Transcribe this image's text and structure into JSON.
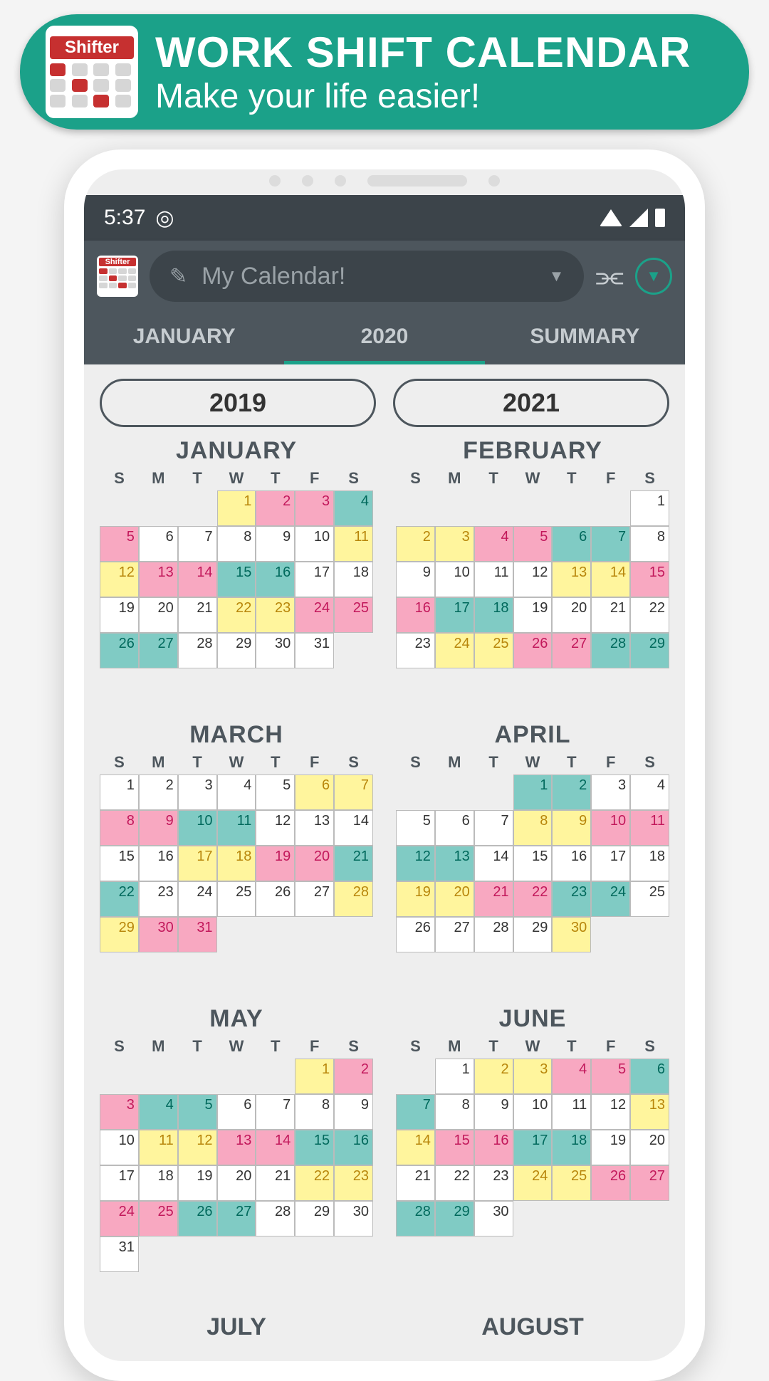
{
  "banner": {
    "logo_label": "Shifter",
    "title": "WORK SHIFT CALENDAR",
    "subtitle": "Make your life easier!"
  },
  "statusbar": {
    "time": "5:37"
  },
  "appbar": {
    "logo_label": "Shifter",
    "dropdown_label": "My Calendar!"
  },
  "tabs": {
    "left": "JANUARY",
    "center": "2020",
    "right": "SUMMARY"
  },
  "year_nav": {
    "prev": "2019",
    "next": "2021"
  },
  "dow": [
    "S",
    "M",
    "T",
    "W",
    "T",
    "F",
    "S"
  ],
  "colors": {
    "yellow": "#fff59d",
    "pink": "#f8a8c1",
    "teal": "#80cbc4",
    "white": "#ffffff"
  },
  "months": [
    {
      "name": "JANUARY",
      "offset": 3,
      "ndays": 31,
      "shifts": {
        "1": "y",
        "2": "p",
        "3": "p",
        "4": "t",
        "5": "p",
        "11": "y",
        "12": "y",
        "13": "p",
        "14": "p",
        "15": "t",
        "16": "t",
        "22": "y",
        "23": "y",
        "24": "p",
        "25": "p",
        "26": "t",
        "27": "t"
      }
    },
    {
      "name": "FEBRUARY",
      "offset": 6,
      "ndays": 29,
      "shifts": {
        "2": "y",
        "3": "y",
        "4": "p",
        "5": "p",
        "6": "t",
        "7": "t",
        "13": "y",
        "14": "y",
        "15": "p",
        "16": "p",
        "17": "t",
        "18": "t",
        "24": "y",
        "25": "y",
        "26": "p",
        "27": "p",
        "28": "t",
        "29": "t"
      }
    },
    {
      "name": "MARCH",
      "offset": 0,
      "ndays": 31,
      "shifts": {
        "6": "y",
        "7": "y",
        "8": "p",
        "9": "p",
        "10": "t",
        "11": "t",
        "17": "y",
        "18": "y",
        "19": "p",
        "20": "p",
        "21": "t",
        "22": "t",
        "28": "y",
        "29": "y",
        "30": "p",
        "31": "p"
      }
    },
    {
      "name": "APRIL",
      "offset": 3,
      "ndays": 30,
      "shifts": {
        "1": "t",
        "2": "t",
        "8": "y",
        "9": "y",
        "10": "p",
        "11": "p",
        "12": "t",
        "13": "t",
        "19": "y",
        "20": "y",
        "21": "p",
        "22": "p",
        "23": "t",
        "24": "t",
        "30": "y"
      }
    },
    {
      "name": "MAY",
      "offset": 5,
      "ndays": 31,
      "shifts": {
        "1": "y",
        "2": "p",
        "3": "p",
        "4": "t",
        "5": "t",
        "11": "y",
        "12": "y",
        "13": "p",
        "14": "p",
        "15": "t",
        "16": "t",
        "22": "y",
        "23": "y",
        "24": "p",
        "25": "p",
        "26": "t",
        "27": "t"
      }
    },
    {
      "name": "JUNE",
      "offset": 1,
      "ndays": 30,
      "shifts": {
        "2": "y",
        "3": "y",
        "4": "p",
        "5": "p",
        "6": "t",
        "7": "t",
        "13": "y",
        "14": "y",
        "15": "p",
        "16": "p",
        "17": "t",
        "18": "t",
        "24": "y",
        "25": "y",
        "26": "p",
        "27": "p",
        "28": "t",
        "29": "t"
      }
    }
  ],
  "partial": {
    "left": "JULY",
    "right": "AUGUST"
  }
}
